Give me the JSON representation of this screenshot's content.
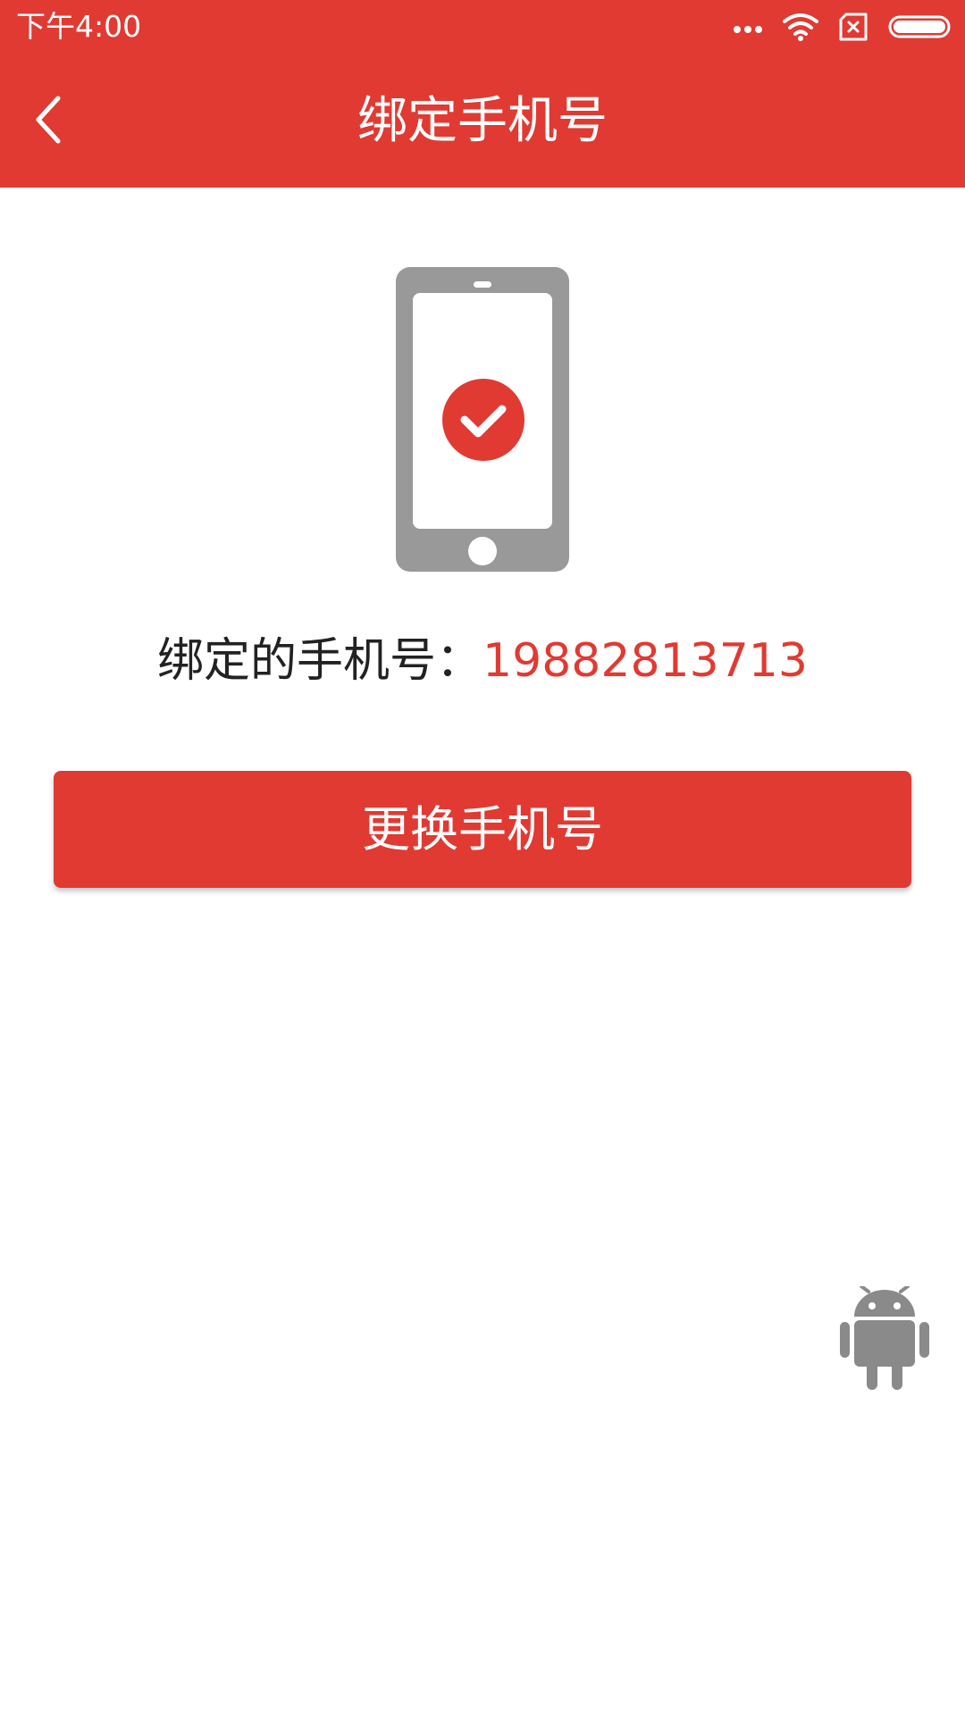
{
  "status_bar": {
    "time": "下午4:00",
    "icons": [
      "more-dots-icon",
      "wifi-icon",
      "no-sim-icon",
      "battery-icon"
    ]
  },
  "app_bar": {
    "back_icon": "chevron-left-icon",
    "title": "绑定手机号"
  },
  "illustration": {
    "icon": "phone-check-icon"
  },
  "bound_phone": {
    "label": "绑定的手机号：",
    "number": "19882813713"
  },
  "actions": {
    "change_label": "更换手机号"
  },
  "floating": {
    "icon": "android-icon"
  },
  "colors": {
    "accent": "#E03A33",
    "phone_gray": "#999999",
    "text_dark": "#222222"
  }
}
